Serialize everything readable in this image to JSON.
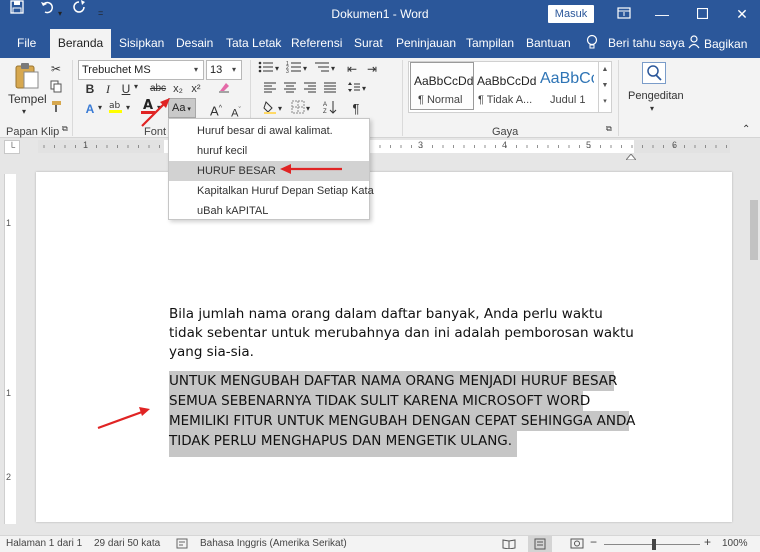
{
  "window": {
    "title": "Dokumen1  -  Word",
    "signin": "Masuk"
  },
  "tabs": [
    "File",
    "Beranda",
    "Sisipkan",
    "Desain",
    "Tata Letak",
    "Referensi",
    "Surat",
    "Peninjauan",
    "Tampilan",
    "Bantuan"
  ],
  "tellme": "Beri tahu saya",
  "share": "Bagikan",
  "ribbon": {
    "paste_label": "Tempel",
    "font_name": "Trebuchet MS",
    "font_size": "13",
    "change_case_label": "Aa",
    "groups": [
      "Papan Klip",
      "Font",
      "Gaya"
    ],
    "editing_label": "Pengeditan",
    "styles": [
      {
        "preview": "AaBbCcDd",
        "name": "¶ Normal"
      },
      {
        "preview": "AaBbCcDd",
        "name": "¶ Tidak A..."
      },
      {
        "preview": "AaBbCc",
        "name": "Judul 1"
      }
    ]
  },
  "change_case_menu": [
    "Huruf besar di awal kalimat.",
    "huruf kecil",
    "HURUF BESAR",
    "Kapitalkan Huruf Depan Setiap Kata",
    "uBah kAPITAL"
  ],
  "ruler_numbers": [
    "1",
    "2",
    "3",
    "4",
    "5",
    "6"
  ],
  "vruler_numbers": [
    "1",
    "1",
    "2"
  ],
  "document": {
    "para1": [
      "Bila jumlah nama orang dalam daftar banyak, Anda perlu waktu",
      "tidak sebentar untuk merubahnya dan ini adalah pemborosan waktu",
      "yang sia-sia."
    ],
    "para2": [
      "UNTUK MENGUBAH DAFTAR NAMA ORANG MENJADI HURUF BESAR",
      "SEMUA SEBENARNYA TIDAK SULIT KARENA MICROSOFT WORD",
      "MEMILIKI FITUR UNTUK MENGUBAH DENGAN CEPAT SEHINGGA ANDA",
      "TIDAK PERLU MENGHAPUS DAN MENGETIK ULANG."
    ]
  },
  "status": {
    "page": "Halaman 1 dari 1",
    "words": "29 dari 50 kata",
    "language": "Bahasa Inggris (Amerika Serikat)",
    "zoom": "100%"
  },
  "colors": {
    "brand": "#2b579a",
    "annotation_arrow": "#e02424",
    "font_color_bar": "#e02424",
    "selection": "#c6c6c6"
  }
}
